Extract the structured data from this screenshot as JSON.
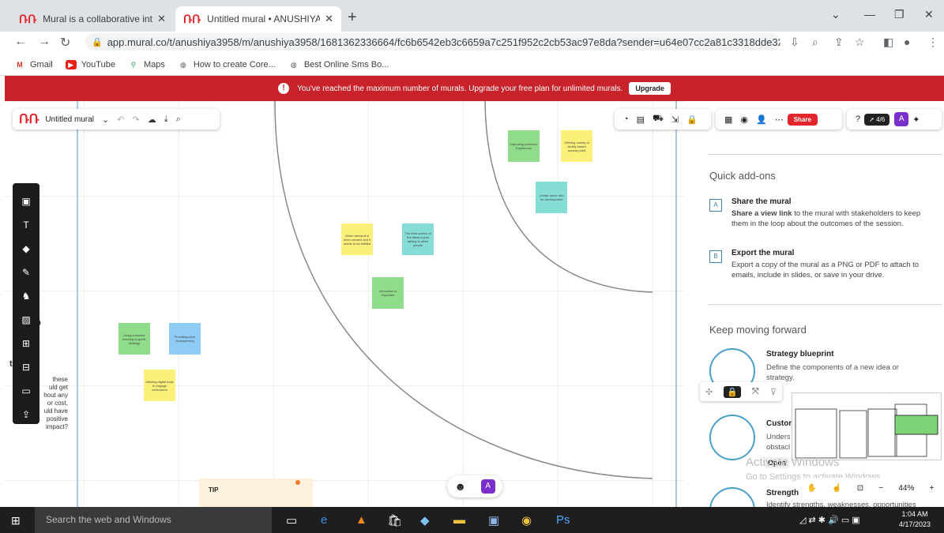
{
  "browser": {
    "tabs": [
      {
        "title": "Mural is a collaborative intelligen",
        "active": false
      },
      {
        "title": "Untitled mural • ANUSHIYA",
        "active": true
      }
    ],
    "url": "app.mural.co/t/anushiya3958/m/anushiya3958/1681362336664/fc6b6542eb3c6659a7c251f952c2cb53ac97e8da?sender=u64e07cc2a81c3318dde32536",
    "bookmarks": [
      "Gmail",
      "YouTube",
      "Maps",
      "How to create Core...",
      "Best Online Sms Bo..."
    ]
  },
  "banner": {
    "message": "You've reached the maximum number of murals. Upgrade your free plan for unlimited murals.",
    "button": "Upgrade"
  },
  "toolbar": {
    "mural_name": "Untitled mural",
    "share_label": "Share",
    "timer_label": "4/6",
    "avatar_letter": "A"
  },
  "canvas": {
    "stickies": [
      {
        "text": "Improving customer Experience",
        "color": "green"
      },
      {
        "text": "Offering variety of facility based access point",
        "color": "yellow"
      },
      {
        "text": "Create some ads for development",
        "color": "teal"
      },
      {
        "text": "When demand is been created and it needs to be fulfilled",
        "color": "yellow"
      },
      {
        "text": "The best source of the ideas is just talking to other people",
        "color": "teal"
      },
      {
        "text": "Innovation is important",
        "color": "green"
      },
      {
        "text": "Using customer learning to guide strategy",
        "color": "green"
      },
      {
        "text": "Providing price Transparency",
        "color": "blue"
      },
      {
        "text": "Utilizing digital tools to engage consumers",
        "color": "yellow"
      }
    ],
    "left_text": {
      "heading": "tance",
      "body": [
        "these",
        "uld get",
        "hout any",
        "or cost,",
        "uld have",
        "positive",
        "impact?"
      ]
    },
    "tip": "TIP"
  },
  "panel": {
    "quick_addons_title": "Quick add-ons",
    "addons": [
      {
        "letter": "A",
        "title": "Share the mural",
        "desc_bold": "Share a view link",
        "desc": " to the mural with stakeholders to keep them in the loop about the outcomes of the session."
      },
      {
        "letter": "B",
        "title": "Export the mural",
        "desc_bold": "",
        "desc": "Export a copy of the mural as a PNG or PDF to attach to emails, include in slides, or save in your drive."
      }
    ],
    "keep_moving_title": "Keep moving forward",
    "blueprints": [
      {
        "title": "Strategy blueprint",
        "desc": "Define the components of a new idea or strategy."
      },
      {
        "title": "Custon",
        "desc": "Unders obstacl"
      },
      {
        "title": "Strength",
        "desc": "Identify strengths, weaknesses, opportunities"
      }
    ],
    "open_label": "Open"
  },
  "overlay": {
    "activate_title": "Activate Windows",
    "activate_sub": "Go to Settings to activate Windows.",
    "zoom": "44%"
  },
  "taskbar": {
    "search_placeholder": "Search the web and Windows",
    "time": "1:04 AM",
    "date": "4/17/2023"
  }
}
